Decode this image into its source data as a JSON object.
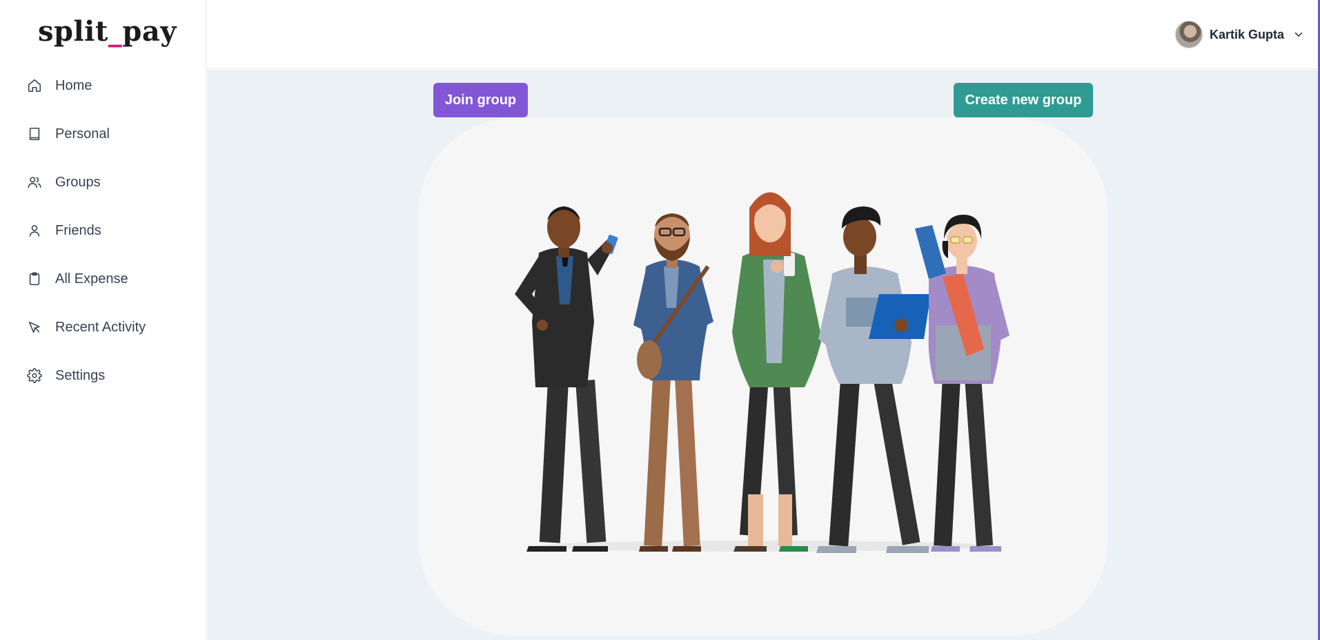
{
  "app": {
    "logo_left": "split",
    "logo_sep": "_",
    "logo_right": "pay"
  },
  "sidebar": {
    "items": [
      {
        "label": "Home",
        "icon": "home-icon"
      },
      {
        "label": "Personal",
        "icon": "book-icon"
      },
      {
        "label": "Groups",
        "icon": "users-icon"
      },
      {
        "label": "Friends",
        "icon": "user-icon"
      },
      {
        "label": "All Expense",
        "icon": "clipboard-icon"
      },
      {
        "label": "Recent Activity",
        "icon": "pointer-icon"
      },
      {
        "label": "Settings",
        "icon": "gear-icon"
      }
    ]
  },
  "header": {
    "user_name": "Kartik Gupta",
    "menu_icon": "chevron-down-icon"
  },
  "main": {
    "join_button": "Join group",
    "create_button": "Create new group",
    "illustration": "group-of-people-illustration"
  },
  "colors": {
    "join_button": "#8157d6",
    "create_button": "#2f9b92",
    "logo_accent": "#d6177a",
    "main_background": "#ecf1f6"
  }
}
